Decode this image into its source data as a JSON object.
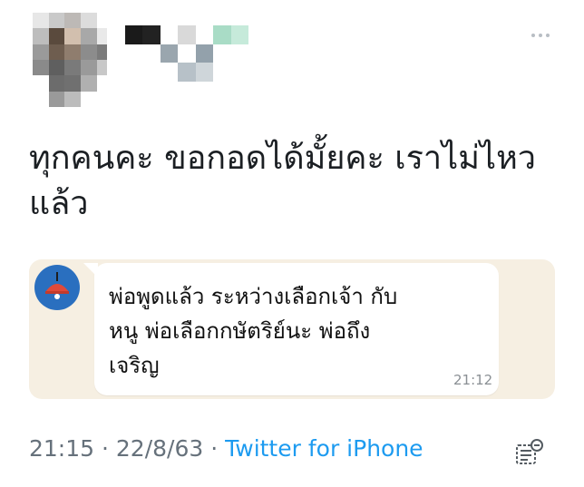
{
  "more_icon": "more-horizontal-icon",
  "tweet": {
    "text": "ทุกคนคะ ขอกอดได้มั้ยคะ เราไม่ไหว\nแล้ว"
  },
  "chat": {
    "avatar_icon": "red-lamp-icon",
    "message": "พ่อพูดแล้ว ระหว่างเลือกเจ้า กับ\nหนู พ่อเลือกกษัตริย์นะ พ่อถึง\nเจริญ",
    "time": "21:12"
  },
  "meta": {
    "time": "21:15",
    "separator1": " · ",
    "date": "22/8/63",
    "separator2": " · ",
    "source": "Twitter for iPhone"
  },
  "analytics_icon": "tweet-analytics-icon",
  "colors": {
    "link_blue": "#1d9bf0",
    "chat_background": "#f6efe2",
    "avatar_blue": "#2a6fbf",
    "lamp_red": "#e04a3a"
  }
}
